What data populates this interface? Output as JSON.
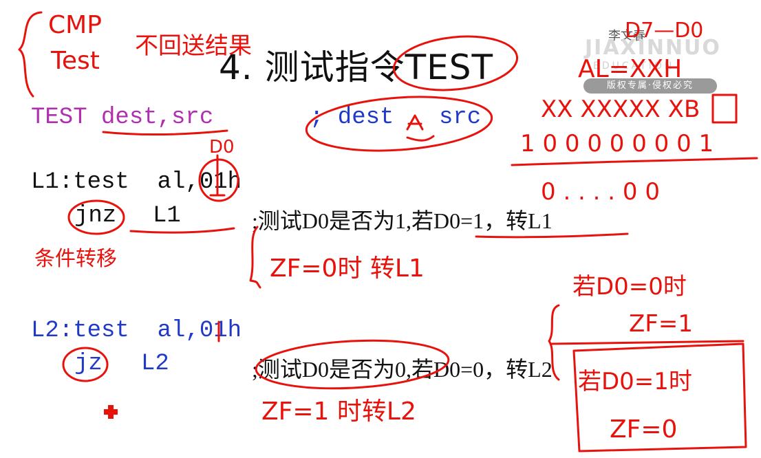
{
  "slide": {
    "title": "4. 测试指令TEST",
    "syntax_line": {
      "instr": "TEST dest,src",
      "comment": "; dest",
      "comment_tail": "src"
    },
    "block1": {
      "line1": "L1:test  al,01h",
      "line2_instr": "jnz",
      "line2_label": "L1",
      "line2_comment": ";测试D0是否为1,若D0=1，转L1"
    },
    "block2": {
      "line1": "L2:test  al,01h",
      "line2_instr": "jz",
      "line2_label": "L2",
      "line2_comment": ";测试D0是否为0,若D0=0，转L2"
    }
  },
  "watermark": {
    "name": "李文春",
    "brand": "JIAXINNUO",
    "sub": "EDUCATION",
    "badge": "版权专属·侵权必究"
  },
  "annotations": {
    "top_left": [
      "CMP",
      "Test",
      "不回送结果"
    ],
    "d0_label": "D0",
    "right_top": "D7—D0",
    "right_al": "AL=XXH",
    "right_bits1": "XX XXXXX XB",
    "right_bits2": "1 0 0 0 0 0 0 0 1",
    "right_bits3": "0 . . . . 0 0",
    "left_note": "条件转移",
    "mid_note1": "ZF=0时 转L1",
    "mid_note2": "ZF=1 时转L2",
    "right_case1": [
      "若D0=0时",
      "ZF=1"
    ],
    "right_case2": [
      "若D0=1时",
      "ZF=0"
    ]
  }
}
